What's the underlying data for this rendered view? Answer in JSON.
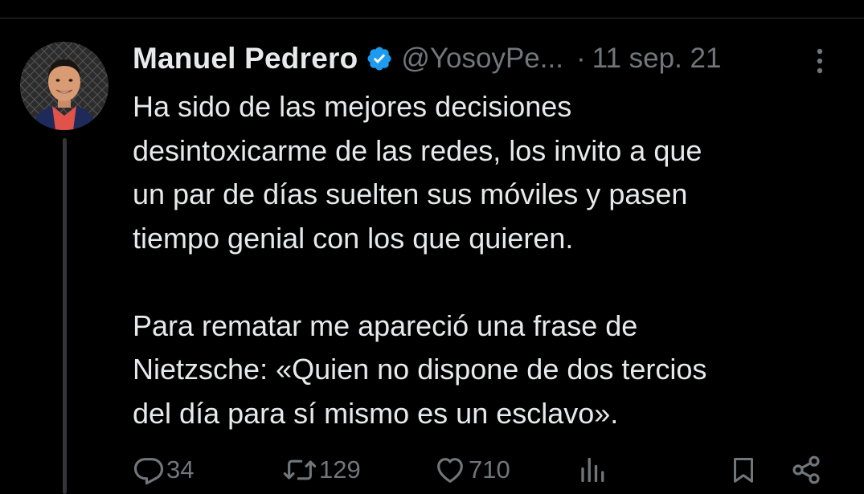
{
  "tweet": {
    "display_name": "Manuel Pedrero",
    "handle": "@YosoyPe...",
    "separator": "·",
    "timestamp": "11 sep. 21",
    "paragraphs": [
      "Ha sido de las mejores decisiones desintoxicarme de las redes, los invito a que un par de días suelten sus móviles y pasen tiempo genial con los que quieren.",
      "Para rematar me apareció una frase de Nietzsche: «Quien no dispone de dos tercios del día para sí mismo es un esclavo»."
    ],
    "lines": [
      "Ha sido de las mejores decisiones",
      "desintoxicarme de las redes, los invito a que",
      "un par de días suelten sus móviles y pasen",
      "tiempo genial con los que quieren.",
      "Para rematar me apareció una frase de",
      "Nietzsche: «Quien no dispone de dos tercios",
      "del día para sí mismo es un esclavo»."
    ],
    "actions": {
      "reply_count": "34",
      "retweet_count": "129",
      "like_count": "710"
    }
  },
  "icons": {
    "verified": "verified-badge-icon",
    "more": "more-options-icon",
    "reply": "reply-icon",
    "retweet": "retweet-icon",
    "like": "heart-icon",
    "views": "views-icon",
    "bookmark": "bookmark-icon",
    "share": "share-icon"
  },
  "colors": {
    "background": "#000000",
    "text_primary": "#e7e9ea",
    "text_secondary": "#71767b",
    "verified_blue": "#1d9bf0",
    "thread_line": "#333639"
  }
}
